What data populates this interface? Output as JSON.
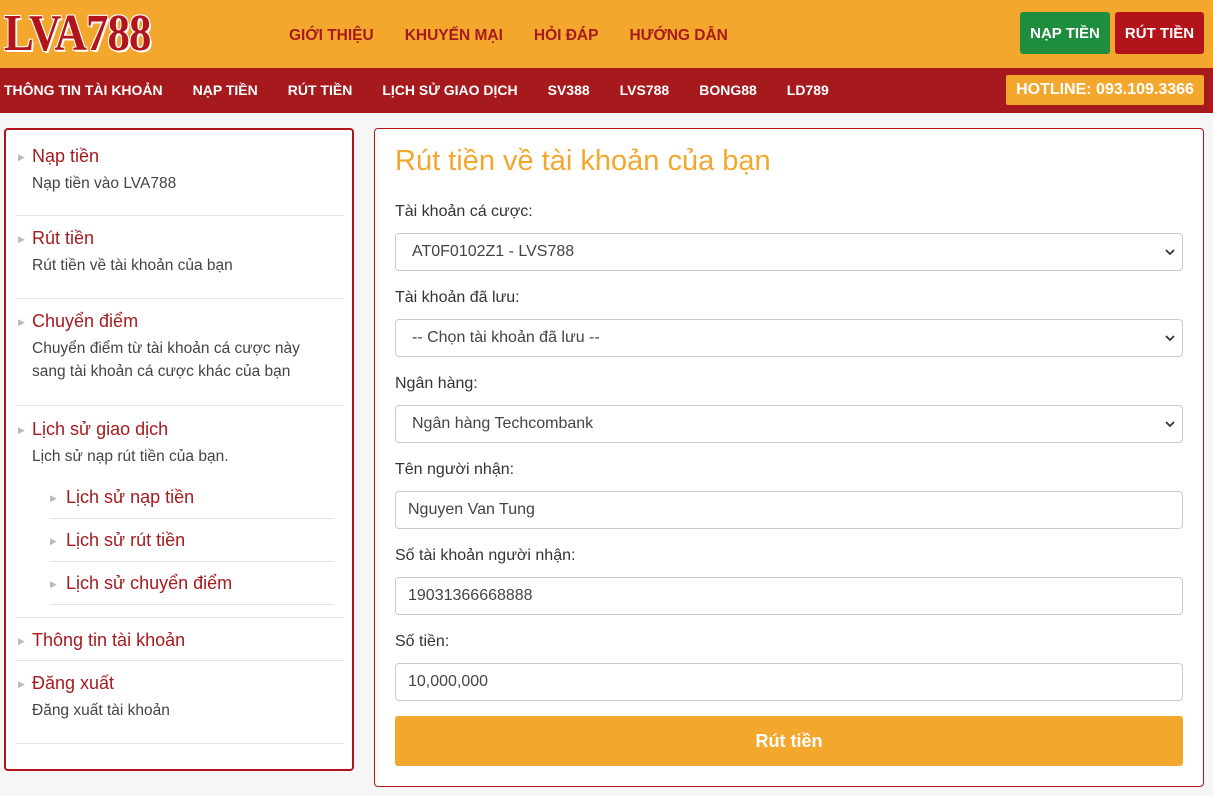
{
  "header": {
    "logo": "LVA788",
    "nav": [
      "GIỚI THIỆU",
      "KHUYẾN MẠI",
      "HỎI ĐÁP",
      "HƯỚNG DẪN"
    ],
    "deposit_button": "NẠP TIỀN",
    "withdraw_button": "RÚT TIỀN"
  },
  "subnav": {
    "items": [
      "THÔNG TIN TÀI KHOẢN",
      "NẠP TIỀN",
      "RÚT TIỀN",
      "LỊCH SỬ GIAO DỊCH",
      "SV388",
      "LVS788",
      "BONG88",
      "LD789"
    ],
    "hotline": "HOTLINE: 093.109.3366"
  },
  "sidebar": {
    "deposit": {
      "title": "Nạp tiền",
      "desc": "Nạp tiền vào LVA788"
    },
    "withdraw": {
      "title": "Rút tiền",
      "desc": "Rút tiền về tài khoản của bạn"
    },
    "transfer": {
      "title": "Chuyển điểm",
      "desc": "Chuyển điểm từ tài khoản cá cược này sang tài khoản cá cược khác của bạn"
    },
    "history": {
      "title": "Lịch sử giao dịch",
      "desc": "Lịch sử nạp rút tiền của bạn."
    },
    "history_sub": [
      "Lịch sử nạp tiền",
      "Lịch sử rút tiền",
      "Lịch sử chuyển điểm"
    ],
    "account": {
      "title": "Thông tin tài khoản"
    },
    "logout": {
      "title": "Đăng xuất",
      "desc": "Đăng xuất tài khoản"
    }
  },
  "form": {
    "heading": "Rút tiền về tài khoản của bạn",
    "bet_account_label": "Tài khoản cá cược:",
    "bet_account_value": "AT0F0102Z1 - LVS788",
    "saved_account_label": "Tài khoản đã lưu:",
    "saved_account_value": "-- Chọn tài khoản đã lưu --",
    "bank_label": "Ngân hàng:",
    "bank_value": "Ngân hàng Techcombank",
    "recipient_name_label": "Tên người nhận:",
    "recipient_name_value": "Nguyen Van Tung",
    "recipient_account_label": "Số tài khoản người nhận:",
    "recipient_account_value": "19031366668888",
    "amount_label": "Số tiền:",
    "amount_value": "10,000,000",
    "submit_label": "Rút tiền"
  },
  "colors": {
    "brand_orange": "#f4a72d",
    "brand_red": "#a61a1e",
    "green": "#1e8e3e"
  }
}
